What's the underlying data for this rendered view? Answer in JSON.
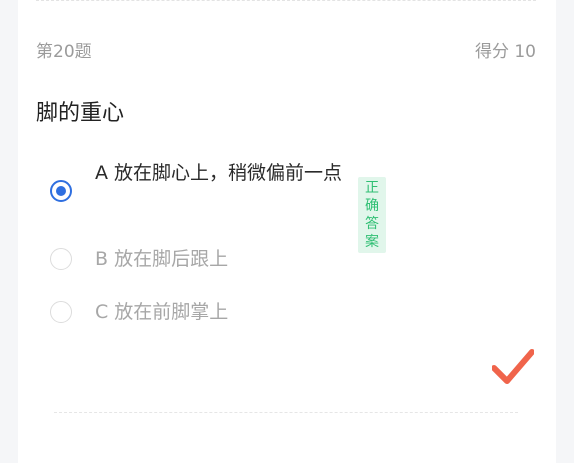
{
  "question": {
    "number_label": "第20题",
    "score_label": "得分 10",
    "title": "脚的重心"
  },
  "options": [
    {
      "text": "A 放在脚心上，稍微偏前一点",
      "selected": true
    },
    {
      "text": "B 放在脚后跟上",
      "selected": false
    },
    {
      "text": "C 放在前脚掌上",
      "selected": false
    }
  ],
  "correct_badge": "正确答案",
  "result_icon": "check-mark-icon",
  "colors": {
    "selected_blue": "#2f6fe0",
    "badge_green": "#2fbf73",
    "badge_bg": "#e1f6eb",
    "check_red": "#f0644b"
  }
}
